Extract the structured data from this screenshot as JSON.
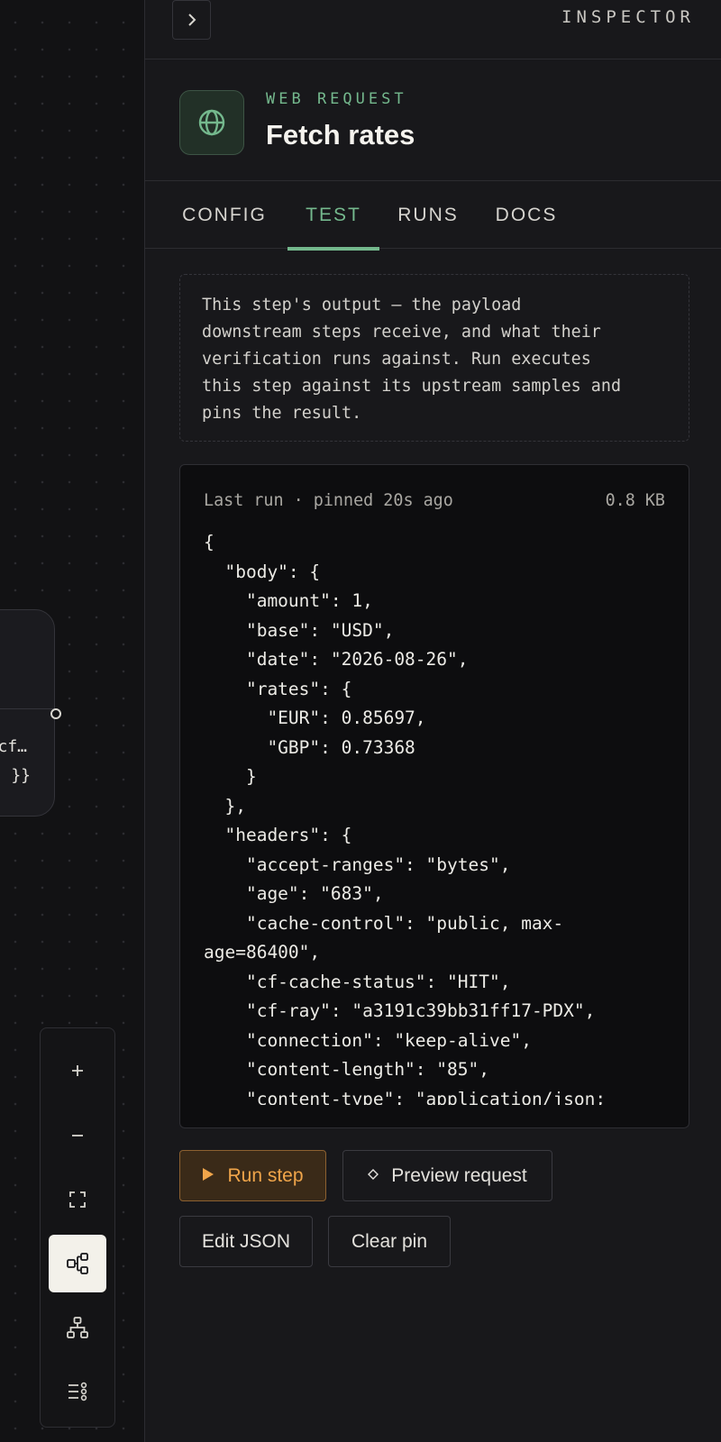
{
  "canvas": {
    "node": {
      "line1": "cf…",
      "line2": "}}"
    }
  },
  "zoom_controls": [
    {
      "name": "zoom-in-button",
      "icon": "plus-icon",
      "glyph": "+"
    },
    {
      "name": "zoom-out-button",
      "icon": "minus-icon",
      "glyph": "−"
    },
    {
      "name": "fit-view-button",
      "icon": "fit-view-icon",
      "glyph": ""
    },
    {
      "name": "flow-layout-button",
      "icon": "flow-layout-icon",
      "glyph": "",
      "active": true
    },
    {
      "name": "tree-layout-button",
      "icon": "tree-layout-icon",
      "glyph": ""
    },
    {
      "name": "list-layout-button",
      "icon": "list-layout-icon",
      "glyph": ""
    }
  ],
  "panel": {
    "inspector_label": "INSPECTOR",
    "node_type": "WEB REQUEST",
    "node_title": "Fetch rates",
    "tabs": [
      {
        "label": "CONFIG",
        "active": false
      },
      {
        "label": "TEST",
        "active": true
      },
      {
        "label": "RUNS",
        "active": false
      },
      {
        "label": "DOCS",
        "active": false
      }
    ],
    "note": "This step's output — the payload\ndownstream steps receive, and what their\nverification runs against. Run executes\nthis step against its upstream samples and\npins the result.",
    "output": {
      "meta": "Last run · pinned 20s ago",
      "size": "0.8 KB",
      "code": "{\n  \"body\": {\n    \"amount\": 1,\n    \"base\": \"USD\",\n    \"date\": \"2026-08-26\",\n    \"rates\": {\n      \"EUR\": 0.85697,\n      \"GBP\": 0.73368\n    }\n  },\n  \"headers\": {\n    \"accept-ranges\": \"bytes\",\n    \"age\": \"683\",\n    \"cache-control\": \"public, max-\nage=86400\",\n    \"cf-cache-status\": \"HIT\",\n    \"cf-ray\": \"a3191c39bb31ff17-PDX\",\n    \"connection\": \"keep-alive\",\n    \"content-length\": \"85\",\n    \"content-type\": \"application/json;"
    },
    "buttons": {
      "run_step": "Run step",
      "preview_request": "Preview request",
      "edit_json": "Edit JSON",
      "clear_pin": "Clear pin"
    }
  },
  "colors": {
    "accent_green": "#74b88d",
    "accent_orange": "#f0a54a",
    "background": "#18181b"
  }
}
